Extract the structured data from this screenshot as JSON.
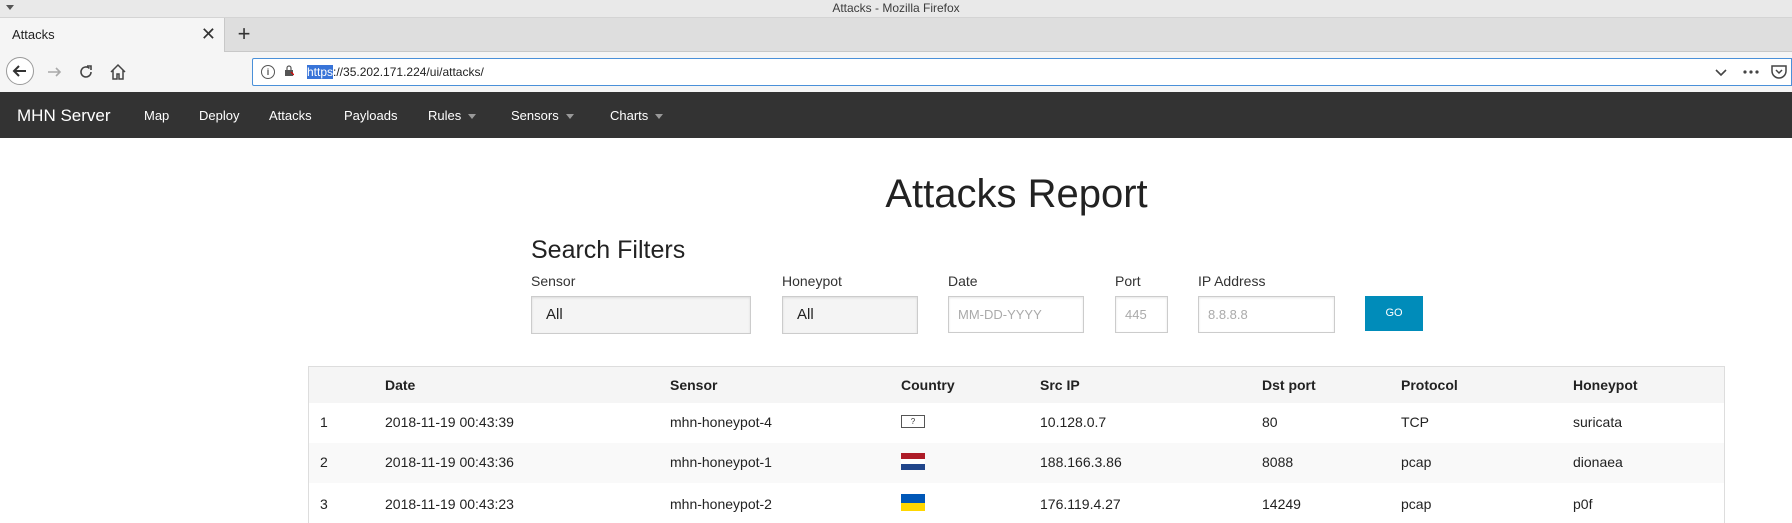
{
  "window": {
    "title": "Attacks - Mozilla Firefox"
  },
  "browser": {
    "tab_title": "Attacks",
    "tab_close": "✕",
    "new_tab": "+",
    "url_protocol": "https",
    "url_rest": "://35.202.171.224/ui/attacks/",
    "icons": [
      "back-arrow-icon",
      "forward-arrow-icon",
      "reload-icon",
      "home-icon",
      "info-icon",
      "lock-icon",
      "chevron-down-icon",
      "more-icon",
      "pocket-icon"
    ]
  },
  "nav": {
    "brand": "MHN Server",
    "items": [
      {
        "label": "Map",
        "dropdown": false
      },
      {
        "label": "Deploy",
        "dropdown": false
      },
      {
        "label": "Attacks",
        "dropdown": false
      },
      {
        "label": "Payloads",
        "dropdown": false
      },
      {
        "label": "Rules",
        "dropdown": true
      },
      {
        "label": "Sensors",
        "dropdown": true
      },
      {
        "label": "Charts",
        "dropdown": true
      }
    ]
  },
  "page": {
    "title": "Attacks Report"
  },
  "filters": {
    "title": "Search Filters",
    "sensor": {
      "label": "Sensor",
      "value": "All"
    },
    "honeypot": {
      "label": "Honeypot",
      "value": "All"
    },
    "date": {
      "label": "Date",
      "placeholder": "MM-DD-YYYY"
    },
    "port": {
      "label": "Port",
      "placeholder": "445"
    },
    "ip": {
      "label": "IP Address",
      "placeholder": "8.8.8.8"
    },
    "go": "GO",
    "accent_color": "#008cba"
  },
  "table": {
    "columns": [
      "",
      "Date",
      "Sensor",
      "Country",
      "Src IP",
      "Dst port",
      "Protocol",
      "Honeypot"
    ],
    "rows": [
      {
        "num": "1",
        "date": "2018-11-19 00:43:39",
        "sensor": "mhn-honeypot-4",
        "country": "?",
        "src_ip": "10.128.0.7",
        "dst_port": "80",
        "protocol": "TCP",
        "honeypot": "suricata"
      },
      {
        "num": "2",
        "date": "2018-11-19 00:43:36",
        "sensor": "mhn-honeypot-1",
        "country_flag": [
          "#ae1c28",
          "#ffffff",
          "#21468b"
        ],
        "src_ip": "188.166.3.86",
        "dst_port": "8088",
        "protocol": "pcap",
        "honeypot": "dionaea"
      },
      {
        "num": "3",
        "date": "2018-11-19 00:43:23",
        "sensor": "mhn-honeypot-2",
        "country_flag": [
          "#0057b7",
          "#ffd700"
        ],
        "src_ip": "176.119.4.27",
        "dst_port": "14249",
        "protocol": "pcap",
        "honeypot": "p0f"
      }
    ]
  }
}
